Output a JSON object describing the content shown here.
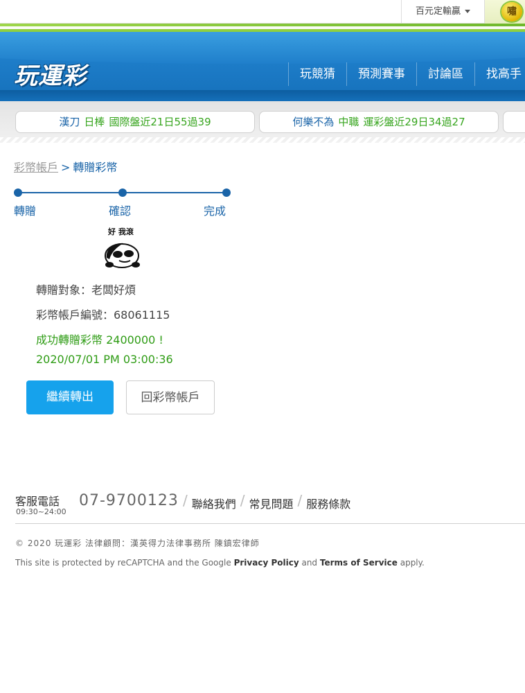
{
  "topbar": {
    "dropdown_label": "百元定輸贏",
    "badge_label": "嘯"
  },
  "header": {
    "logo": "玩運彩",
    "nav": [
      "玩競猜",
      "預測賽事",
      "討論區",
      "找高手"
    ]
  },
  "ticker": [
    {
      "name": "漢刀",
      "league": "日棒",
      "stat": "國際盤近21日55過39"
    },
    {
      "name": "何樂不為",
      "league": "中職",
      "stat": "運彩盤近29日34過27"
    }
  ],
  "breadcrumb": {
    "parent": "彩幣帳戶",
    "separator": ">",
    "current": "轉贈彩幣"
  },
  "steps": [
    "轉贈",
    "確認",
    "完成"
  ],
  "sticker": {
    "caption": "好 我滾"
  },
  "result": {
    "target": "轉贈對象：老闆好煩",
    "account": "彩幣帳戶編號：68061115",
    "success": "成功轉贈彩幣 2400000 !",
    "timestamp": "2020/07/01 PM 03:00:36"
  },
  "buttons": {
    "continue": "繼續轉出",
    "back": "回彩幣帳戶"
  },
  "footer": {
    "phone_label": "客服電話",
    "hours": "09:30~24:00",
    "phone": "07-9700123",
    "links": [
      "聯絡我們",
      "常見問題",
      "服務條款"
    ],
    "copyright": "© 2020 玩運彩 法律顧問：漢英得力法律事務所 陳鎮宏律師",
    "recaptcha_prefix": "This site is protected by reCAPTCHA and the Google",
    "privacy": "Privacy Policy",
    "and": "and",
    "terms": "Terms of Service",
    "apply": "apply."
  },
  "colors": {
    "brand_blue": "#1f7fcb",
    "link_blue": "#1a64a8",
    "success_green": "#2e9c14",
    "button_blue": "#16a2ec"
  }
}
